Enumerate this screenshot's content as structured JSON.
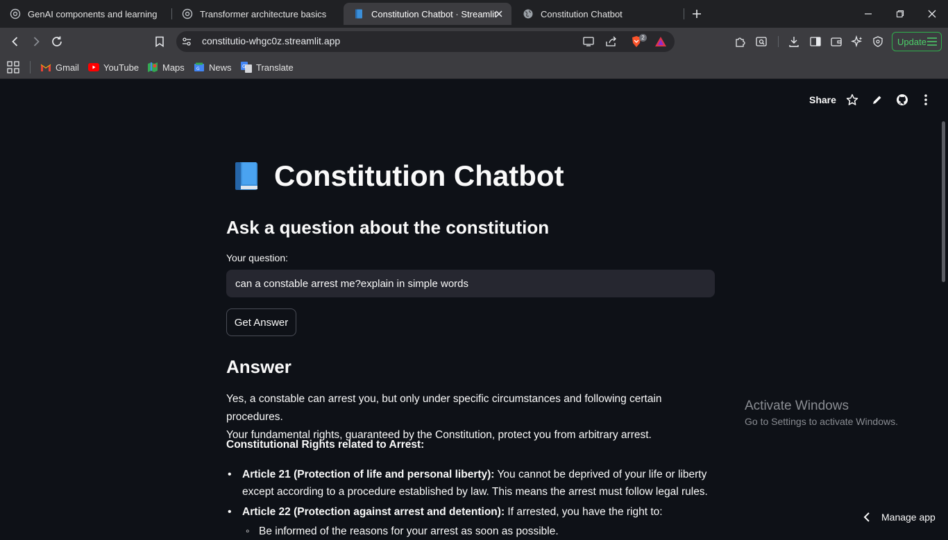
{
  "browser": {
    "tabs": [
      {
        "label": "GenAI components and learning",
        "icon": "openai-icon"
      },
      {
        "label": "Transformer architecture basics",
        "icon": "openai-icon"
      },
      {
        "label": "Constitution Chatbot · Streamlit",
        "icon": "book-icon",
        "active": true
      },
      {
        "label": "Constitution Chatbot",
        "icon": "globe-icon"
      }
    ],
    "url": "constitutio-whgc0z.streamlit.app",
    "brave_badge": "2",
    "update_label": "Update",
    "bookmarks": [
      {
        "label": "Gmail",
        "icon": "gmail-icon"
      },
      {
        "label": "YouTube",
        "icon": "youtube-icon"
      },
      {
        "label": "Maps",
        "icon": "maps-icon"
      },
      {
        "label": "News",
        "icon": "news-icon"
      },
      {
        "label": "Translate",
        "icon": "translate-icon"
      }
    ]
  },
  "app": {
    "header": {
      "share_label": "Share"
    },
    "title": "Constitution Chatbot",
    "subtitle": "Ask a question about the constitution",
    "question_label": "Your question:",
    "question_value": "can a constable arrest me?explain in simple words",
    "button_label": "Get Answer",
    "answer_heading": "Answer",
    "answer": {
      "intro_line1": "Yes, a constable can arrest you, but only under specific circumstances and following certain procedures.",
      "intro_line2": "Your fundamental rights, guaranteed by the Constitution, protect you from arbitrary arrest.",
      "section_heading": "Constitutional Rights related to Arrest:",
      "bullets": [
        {
          "bold": "Article 21 (Protection of life and personal liberty):",
          "text": " You cannot be deprived of your life or liberty",
          "text2": "except according to a procedure established by law. This means the arrest must follow legal rules."
        },
        {
          "bold": "Article 22 (Protection against arrest and detention):",
          "text": " If arrested, you have the right to:"
        }
      ],
      "sub_bullet": "Be informed of the reasons for your arrest as soon as possible."
    },
    "manage_app_label": "Manage app"
  },
  "os_overlay": {
    "activate_title": "Activate Windows",
    "activate_sub": "Go to Settings to activate Windows."
  },
  "colors": {
    "page_bg": "#0e1117",
    "input_bg": "#262730",
    "chrome_bg": "#3c3c40",
    "update_green": "#4dd06a"
  }
}
